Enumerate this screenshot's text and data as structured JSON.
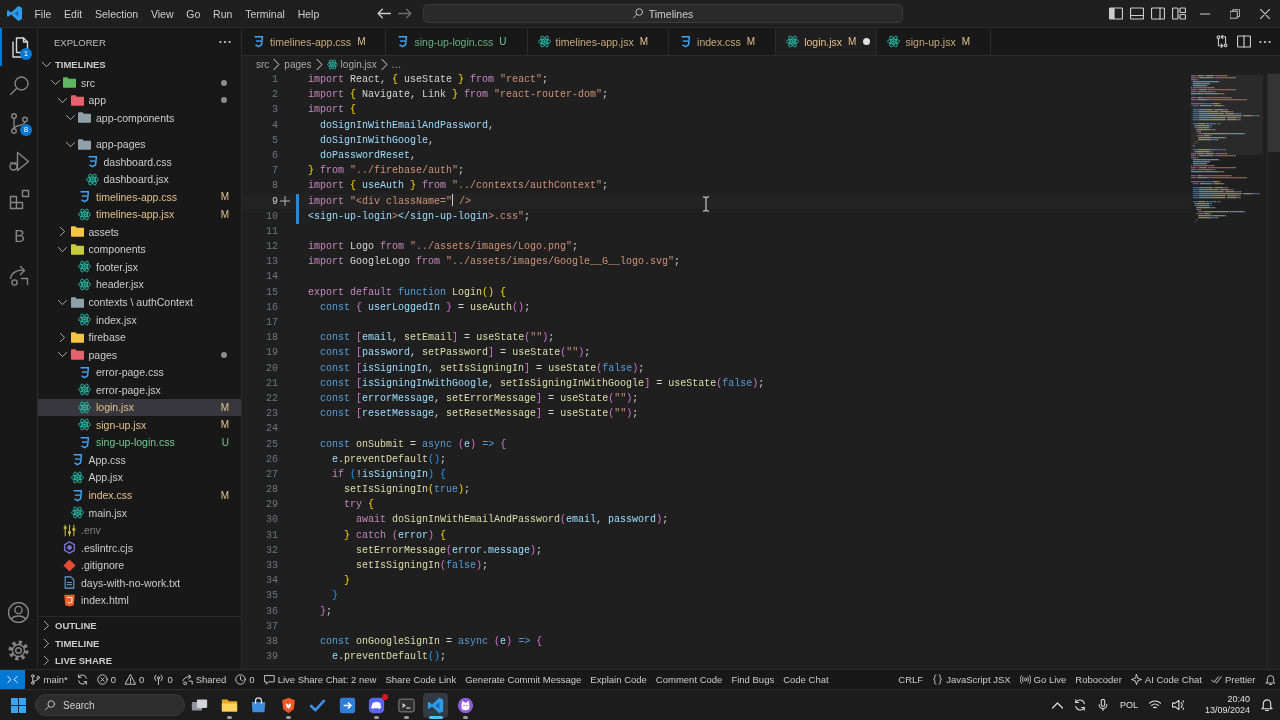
{
  "title_bar": {
    "menu": [
      "File",
      "Edit",
      "Selection",
      "View",
      "Go",
      "Run",
      "Terminal",
      "Help"
    ],
    "command_center": "Timelines"
  },
  "activity_bar": {
    "items": [
      {
        "kind": "files",
        "selected": true,
        "badge": "1"
      },
      {
        "kind": "search",
        "selected": false
      },
      {
        "kind": "source-control",
        "selected": false,
        "badge": "8"
      },
      {
        "kind": "run-debug",
        "selected": false
      },
      {
        "kind": "extensions",
        "selected": false
      },
      {
        "kind": "letter",
        "selected": false,
        "label": "B"
      },
      {
        "kind": "live-share",
        "selected": false
      }
    ],
    "bottom": [
      {
        "kind": "account"
      },
      {
        "kind": "settings"
      }
    ]
  },
  "sidebar": {
    "title": "EXPLORER",
    "workspace": {
      "title": "TIMELINES",
      "expanded": true
    },
    "tree": [
      {
        "name": "src",
        "kind": "folder",
        "color": "#5fb85f",
        "expanded": true,
        "changes": true,
        "selected": false,
        "children": [
          {
            "name": "app",
            "kind": "folder",
            "color": "#e8616f",
            "expanded": true,
            "changes": true,
            "selected": false,
            "children": [
              {
                "name": "app-components",
                "kind": "folder",
                "color": "#8fa0ab",
                "expanded": true,
                "changes": false,
                "selected": false
              },
              {
                "name": "app-pages",
                "kind": "folder",
                "color": "#8fa0ab",
                "expanded": true,
                "changes": false,
                "selected": false,
                "children": [
                  {
                    "name": "dashboard.css",
                    "kind": "css",
                    "modified": false,
                    "untracked": false,
                    "ignored": false,
                    "selected": false
                  },
                  {
                    "name": "dashboard.jsx",
                    "kind": "jsx",
                    "modified": false,
                    "untracked": false,
                    "ignored": false,
                    "selected": false
                  }
                ]
              },
              {
                "name": "timelines-app.css",
                "kind": "css",
                "modified": true,
                "untracked": false,
                "ignored": false,
                "badge": "M",
                "selected": false
              },
              {
                "name": "timelines-app.jsx",
                "kind": "jsx",
                "modified": true,
                "untracked": false,
                "ignored": false,
                "badge": "M",
                "selected": false
              }
            ]
          },
          {
            "name": "assets",
            "kind": "folder",
            "color": "#f4c542",
            "expanded": false,
            "changes": false,
            "selected": false
          },
          {
            "name": "components",
            "kind": "folder",
            "color": "#c5cc3a",
            "expanded": true,
            "changes": false,
            "selected": false,
            "children": [
              {
                "name": "footer.jsx",
                "kind": "jsx",
                "modified": false,
                "untracked": false,
                "ignored": false,
                "selected": false
              },
              {
                "name": "header.jsx",
                "kind": "jsx",
                "modified": false,
                "untracked": false,
                "ignored": false,
                "selected": false
              }
            ]
          },
          {
            "name": "contexts \\ authContext",
            "kind": "folder",
            "color": "#8fa0ab",
            "expanded": true,
            "changes": false,
            "selected": false,
            "children": [
              {
                "name": "index.jsx",
                "kind": "jsx",
                "modified": false,
                "untracked": false,
                "ignored": false,
                "selected": false
              }
            ]
          },
          {
            "name": "firebase",
            "kind": "folder",
            "color": "#f4c542",
            "expanded": false,
            "changes": false,
            "selected": false
          },
          {
            "name": "pages",
            "kind": "folder",
            "color": "#e8616f",
            "expanded": true,
            "changes": true,
            "selected": false,
            "children": [
              {
                "name": "error-page.css",
                "kind": "css",
                "modified": false,
                "untracked": false,
                "ignored": false,
                "selected": false
              },
              {
                "name": "error-page.jsx",
                "kind": "jsx",
                "modified": false,
                "untracked": false,
                "ignored": false,
                "selected": false
              },
              {
                "name": "login.jsx",
                "kind": "jsx",
                "modified": true,
                "untracked": false,
                "ignored": false,
                "badge": "M",
                "selected": true
              },
              {
                "name": "sign-up.jsx",
                "kind": "jsx",
                "modified": true,
                "untracked": false,
                "ignored": false,
                "badge": "M",
                "selected": false
              },
              {
                "name": "sing-up-login.css",
                "kind": "css",
                "modified": false,
                "untracked": true,
                "ignored": false,
                "badge": "U",
                "selected": false
              }
            ]
          },
          {
            "name": "App.css",
            "kind": "css",
            "modified": false,
            "untracked": false,
            "ignored": false,
            "selected": false
          },
          {
            "name": "App.jsx",
            "kind": "jsx",
            "modified": false,
            "untracked": false,
            "ignored": false,
            "selected": false
          },
          {
            "name": "index.css",
            "kind": "css",
            "modified": true,
            "untracked": false,
            "ignored": false,
            "badge": "M",
            "selected": false
          },
          {
            "name": "main.jsx",
            "kind": "jsx",
            "modified": false,
            "untracked": false,
            "ignored": false,
            "selected": false
          }
        ]
      },
      {
        "name": ".env",
        "kind": "env",
        "modified": false,
        "untracked": false,
        "ignored": true,
        "selected": false
      },
      {
        "name": ".eslintrc.cjs",
        "kind": "eslint",
        "modified": false,
        "untracked": false,
        "ignored": false,
        "selected": false
      },
      {
        "name": ".gitignore",
        "kind": "git",
        "modified": false,
        "untracked": false,
        "ignored": false,
        "selected": false
      },
      {
        "name": "days-with-no-work.txt",
        "kind": "txt",
        "modified": false,
        "untracked": false,
        "ignored": false,
        "selected": false
      },
      {
        "name": "index.html",
        "kind": "html",
        "modified": false,
        "untracked": false,
        "ignored": false,
        "selected": false
      }
    ],
    "sections": [
      {
        "title": "OUTLINE",
        "expanded": false
      },
      {
        "title": "TIMELINE",
        "expanded": false
      },
      {
        "title": "LIVE SHARE",
        "expanded": false
      }
    ]
  },
  "editor": {
    "tabs": [
      {
        "label": "timelines-app.css",
        "kind": "css",
        "badge": "M",
        "modified": true,
        "untracked": false,
        "selected": false,
        "dirty": false
      },
      {
        "label": "sing-up-login.css",
        "kind": "css",
        "badge": "U",
        "modified": false,
        "untracked": true,
        "selected": false,
        "dirty": false
      },
      {
        "label": "timelines-app.jsx",
        "kind": "jsx",
        "badge": "M",
        "modified": true,
        "untracked": false,
        "selected": false,
        "dirty": false
      },
      {
        "label": "index.css",
        "kind": "css",
        "badge": "M",
        "modified": true,
        "untracked": false,
        "selected": false,
        "dirty": false
      },
      {
        "label": "login.jsx",
        "kind": "jsx",
        "badge": "M",
        "modified": true,
        "untracked": false,
        "selected": true,
        "dirty": true
      },
      {
        "label": "sign-up.jsx",
        "kind": "jsx",
        "badge": "M",
        "modified": true,
        "untracked": false,
        "selected": false,
        "dirty": false
      }
    ],
    "breadcrumbs": [
      {
        "label": "src",
        "kind": "folder"
      },
      {
        "label": "pages",
        "kind": "folder"
      },
      {
        "label": "login.jsx",
        "kind": "jsx"
      },
      {
        "label": "...",
        "kind": "more"
      }
    ],
    "lines": [
      {
        "number": "1",
        "active": false,
        "changed": false,
        "tokens": [
          {
            "kind": "kw",
            "text": "import"
          },
          {
            "kind": "pl",
            "text": " React, "
          },
          {
            "kind": "b1",
            "text": "{"
          },
          {
            "kind": "pl",
            "text": " useState "
          },
          {
            "kind": "b1",
            "text": "}"
          },
          {
            "kind": "kw",
            "text": " from "
          },
          {
            "kind": "str",
            "text": "\"react\""
          },
          {
            "kind": "pl",
            "text": ";"
          }
        ]
      },
      {
        "number": "2",
        "active": false,
        "changed": false,
        "tokens": [
          {
            "kind": "kw",
            "text": "import"
          },
          {
            "kind": "b1",
            "text": " {"
          },
          {
            "kind": "pl",
            "text": " Navigate, Link "
          },
          {
            "kind": "b1",
            "text": "}"
          },
          {
            "kind": "kw",
            "text": " from "
          },
          {
            "kind": "str",
            "text": "\"react-router-dom\""
          },
          {
            "kind": "pl",
            "text": ";"
          }
        ]
      },
      {
        "number": "3",
        "active": false,
        "changed": false,
        "tokens": [
          {
            "kind": "kw",
            "text": "import"
          },
          {
            "kind": "b1",
            "text": " {"
          }
        ]
      },
      {
        "number": "4",
        "active": false,
        "changed": false,
        "tokens": [
          {
            "kind": "var",
            "text": "  doSignInWithEmailAndPassword"
          },
          {
            "kind": "pl",
            "text": ","
          }
        ]
      },
      {
        "number": "5",
        "active": false,
        "changed": false,
        "tokens": [
          {
            "kind": "var",
            "text": "  doSignInWithGoogle"
          },
          {
            "kind": "pl",
            "text": ","
          }
        ]
      },
      {
        "number": "6",
        "active": false,
        "changed": false,
        "tokens": [
          {
            "kind": "var",
            "text": "  doPasswordReset"
          },
          {
            "kind": "pl",
            "text": ","
          }
        ]
      },
      {
        "number": "7",
        "active": false,
        "changed": false,
        "tokens": [
          {
            "kind": "b1",
            "text": "}"
          },
          {
            "kind": "kw",
            "text": " from "
          },
          {
            "kind": "str",
            "text": "\"../firebase/auth\""
          },
          {
            "kind": "pl",
            "text": ";"
          }
        ]
      },
      {
        "number": "8",
        "active": false,
        "changed": false,
        "tokens": [
          {
            "kind": "kw",
            "text": "import"
          },
          {
            "kind": "b1",
            "text": " {"
          },
          {
            "kind": "var",
            "text": " useAuth "
          },
          {
            "kind": "b1",
            "text": "}"
          },
          {
            "kind": "kw",
            "text": " from "
          },
          {
            "kind": "str",
            "text": "\"../contexts/authContext\""
          },
          {
            "kind": "pl",
            "text": ";"
          }
        ]
      },
      {
        "number": "9",
        "active": true,
        "changed": true,
        "tokens": [
          {
            "kind": "kw",
            "text": "import"
          },
          {
            "kind": "str",
            "text": " \"<div className=\""
          },
          {
            "kind": "caret"
          },
          {
            "kind": "str",
            "text": " />"
          }
        ]
      },
      {
        "number": "10",
        "active": false,
        "changed": true,
        "tokens": [
          {
            "kind": "var",
            "text": "<sign-up-login"
          },
          {
            "kind": "str",
            "text": ">"
          },
          {
            "kind": "var",
            "text": "</sign-up-login"
          },
          {
            "kind": "str",
            "text": ">.css\""
          },
          {
            "kind": "pl",
            "text": ";"
          }
        ]
      },
      {
        "number": "11",
        "active": false,
        "changed": false
      },
      {
        "number": "12",
        "active": false,
        "changed": false,
        "tokens": [
          {
            "kind": "kw",
            "text": "import"
          },
          {
            "kind": "pl",
            "text": " Logo "
          },
          {
            "kind": "kw",
            "text": "from "
          },
          {
            "kind": "str",
            "text": "\"../assets/images/Logo.png\""
          },
          {
            "kind": "pl",
            "text": ";"
          }
        ]
      },
      {
        "number": "13",
        "active": false,
        "changed": false,
        "tokens": [
          {
            "kind": "kw",
            "text": "import"
          },
          {
            "kind": "pl",
            "text": " GoogleLogo "
          },
          {
            "kind": "kw",
            "text": "from "
          },
          {
            "kind": "str",
            "text": "\"../assets/images/Google__G__logo.svg\""
          },
          {
            "kind": "pl",
            "text": ";"
          }
        ]
      },
      {
        "number": "14",
        "active": false,
        "changed": false
      },
      {
        "number": "15",
        "active": false,
        "changed": false,
        "tokens": [
          {
            "kind": "kw",
            "text": "export default "
          },
          {
            "kind": "st",
            "text": "function "
          },
          {
            "kind": "fn",
            "text": "Login"
          },
          {
            "kind": "b1",
            "text": "()"
          },
          {
            "kind": "b1",
            "text": " {"
          }
        ]
      },
      {
        "number": "16",
        "active": false,
        "changed": false,
        "tokens": [
          {
            "kind": "st",
            "text": "  const "
          },
          {
            "kind": "b2",
            "text": "{"
          },
          {
            "kind": "var",
            "text": " userLoggedIn "
          },
          {
            "kind": "b2",
            "text": "}"
          },
          {
            "kind": "pl",
            "text": " = "
          },
          {
            "kind": "fn",
            "text": "useAuth"
          },
          {
            "kind": "b2",
            "text": "()"
          },
          {
            "kind": "pl",
            "text": ";"
          }
        ]
      },
      {
        "number": "17",
        "active": false,
        "changed": false
      },
      {
        "number": "18",
        "active": false,
        "changed": false,
        "tokens": [
          {
            "kind": "st",
            "text": "  const "
          },
          {
            "kind": "b2",
            "text": "["
          },
          {
            "kind": "var",
            "text": "email"
          },
          {
            "kind": "pl",
            "text": ", "
          },
          {
            "kind": "fn",
            "text": "setEmail"
          },
          {
            "kind": "b2",
            "text": "]"
          },
          {
            "kind": "pl",
            "text": " = "
          },
          {
            "kind": "fn",
            "text": "useState"
          },
          {
            "kind": "b2",
            "text": "("
          },
          {
            "kind": "str",
            "text": "\"\""
          },
          {
            "kind": "b2",
            "text": ")"
          },
          {
            "kind": "pl",
            "text": ";"
          }
        ]
      },
      {
        "number": "19",
        "active": false,
        "changed": false,
        "tokens": [
          {
            "kind": "st",
            "text": "  const "
          },
          {
            "kind": "b2",
            "text": "["
          },
          {
            "kind": "var",
            "text": "password"
          },
          {
            "kind": "pl",
            "text": ", "
          },
          {
            "kind": "fn",
            "text": "setPassword"
          },
          {
            "kind": "b2",
            "text": "]"
          },
          {
            "kind": "pl",
            "text": " = "
          },
          {
            "kind": "fn",
            "text": "useState"
          },
          {
            "kind": "b2",
            "text": "("
          },
          {
            "kind": "str",
            "text": "\"\""
          },
          {
            "kind": "b2",
            "text": ")"
          },
          {
            "kind": "pl",
            "text": ";"
          }
        ]
      },
      {
        "number": "20",
        "active": false,
        "changed": false,
        "tokens": [
          {
            "kind": "st",
            "text": "  const "
          },
          {
            "kind": "b2",
            "text": "["
          },
          {
            "kind": "var",
            "text": "isSigningIn"
          },
          {
            "kind": "pl",
            "text": ", "
          },
          {
            "kind": "fn",
            "text": "setIsSigningIn"
          },
          {
            "kind": "b2",
            "text": "]"
          },
          {
            "kind": "pl",
            "text": " = "
          },
          {
            "kind": "fn",
            "text": "useState"
          },
          {
            "kind": "b2",
            "text": "("
          },
          {
            "kind": "st",
            "text": "false"
          },
          {
            "kind": "b2",
            "text": ")"
          },
          {
            "kind": "pl",
            "text": ";"
          }
        ]
      },
      {
        "number": "21",
        "active": false,
        "changed": false,
        "tokens": [
          {
            "kind": "st",
            "text": "  const "
          },
          {
            "kind": "b2",
            "text": "["
          },
          {
            "kind": "var",
            "text": "isSigningInWithGoogle"
          },
          {
            "kind": "pl",
            "text": ", "
          },
          {
            "kind": "fn",
            "text": "setIsSigningInWithGoogle"
          },
          {
            "kind": "b2",
            "text": "]"
          },
          {
            "kind": "pl",
            "text": " = "
          },
          {
            "kind": "fn",
            "text": "useState"
          },
          {
            "kind": "b2",
            "text": "("
          },
          {
            "kind": "st",
            "text": "false"
          },
          {
            "kind": "b2",
            "text": ")"
          },
          {
            "kind": "pl",
            "text": ";"
          }
        ]
      },
      {
        "number": "22",
        "active": false,
        "changed": false,
        "tokens": [
          {
            "kind": "st",
            "text": "  const "
          },
          {
            "kind": "b2",
            "text": "["
          },
          {
            "kind": "var",
            "text": "errorMessage"
          },
          {
            "kind": "pl",
            "text": ", "
          },
          {
            "kind": "fn",
            "text": "setErrorMessage"
          },
          {
            "kind": "b2",
            "text": "]"
          },
          {
            "kind": "pl",
            "text": " = "
          },
          {
            "kind": "fn",
            "text": "useState"
          },
          {
            "kind": "b2",
            "text": "("
          },
          {
            "kind": "str",
            "text": "\"\""
          },
          {
            "kind": "b2",
            "text": ")"
          },
          {
            "kind": "pl",
            "text": ";"
          }
        ]
      },
      {
        "number": "23",
        "active": false,
        "changed": false,
        "tokens": [
          {
            "kind": "st",
            "text": "  const "
          },
          {
            "kind": "b2",
            "text": "["
          },
          {
            "kind": "var",
            "text": "resetMessage"
          },
          {
            "kind": "pl",
            "text": ", "
          },
          {
            "kind": "fn",
            "text": "setResetMessage"
          },
          {
            "kind": "b2",
            "text": "]"
          },
          {
            "kind": "pl",
            "text": " = "
          },
          {
            "kind": "fn",
            "text": "useState"
          },
          {
            "kind": "b2",
            "text": "("
          },
          {
            "kind": "str",
            "text": "\"\""
          },
          {
            "kind": "b2",
            "text": ")"
          },
          {
            "kind": "pl",
            "text": ";"
          }
        ]
      },
      {
        "number": "24",
        "active": false,
        "changed": false
      },
      {
        "number": "25",
        "active": false,
        "changed": false,
        "tokens": [
          {
            "kind": "st",
            "text": "  const "
          },
          {
            "kind": "fn",
            "text": "onSubmit"
          },
          {
            "kind": "pl",
            "text": " = "
          },
          {
            "kind": "st",
            "text": "async "
          },
          {
            "kind": "b2",
            "text": "("
          },
          {
            "kind": "var",
            "text": "e"
          },
          {
            "kind": "b2",
            "text": ")"
          },
          {
            "kind": "st",
            "text": " => "
          },
          {
            "kind": "b2",
            "text": "{"
          }
        ]
      },
      {
        "number": "26",
        "active": false,
        "changed": false,
        "tokens": [
          {
            "kind": "var",
            "text": "    e"
          },
          {
            "kind": "pl",
            "text": "."
          },
          {
            "kind": "fn",
            "text": "preventDefault"
          },
          {
            "kind": "b3",
            "text": "()"
          },
          {
            "kind": "pl",
            "text": ";"
          }
        ]
      },
      {
        "number": "27",
        "active": false,
        "changed": false,
        "tokens": [
          {
            "kind": "kw",
            "text": "    if "
          },
          {
            "kind": "b3",
            "text": "("
          },
          {
            "kind": "pl",
            "text": "!"
          },
          {
            "kind": "var",
            "text": "isSigningIn"
          },
          {
            "kind": "b3",
            "text": ")"
          },
          {
            "kind": "b3",
            "text": " {"
          }
        ]
      },
      {
        "number": "28",
        "active": false,
        "changed": false,
        "tokens": [
          {
            "kind": "fn",
            "text": "      setIsSigningIn"
          },
          {
            "kind": "b1",
            "text": "("
          },
          {
            "kind": "st",
            "text": "true"
          },
          {
            "kind": "b1",
            "text": ")"
          },
          {
            "kind": "pl",
            "text": ";"
          }
        ]
      },
      {
        "number": "29",
        "active": false,
        "changed": false,
        "tokens": [
          {
            "kind": "kw",
            "text": "      try "
          },
          {
            "kind": "b1",
            "text": "{"
          }
        ]
      },
      {
        "number": "30",
        "active": false,
        "changed": false,
        "tokens": [
          {
            "kind": "kw",
            "text": "        await "
          },
          {
            "kind": "fn",
            "text": "doSignInWithEmailAndPassword"
          },
          {
            "kind": "b2",
            "text": "("
          },
          {
            "kind": "var",
            "text": "email"
          },
          {
            "kind": "pl",
            "text": ", "
          },
          {
            "kind": "var",
            "text": "password"
          },
          {
            "kind": "b2",
            "text": ")"
          },
          {
            "kind": "pl",
            "text": ";"
          }
        ]
      },
      {
        "number": "31",
        "active": false,
        "changed": false,
        "tokens": [
          {
            "kind": "b1",
            "text": "      }"
          },
          {
            "kind": "kw",
            "text": " catch "
          },
          {
            "kind": "b2",
            "text": "("
          },
          {
            "kind": "var",
            "text": "error"
          },
          {
            "kind": "b2",
            "text": ")"
          },
          {
            "kind": "b1",
            "text": " {"
          }
        ]
      },
      {
        "number": "32",
        "active": false,
        "changed": false,
        "tokens": [
          {
            "kind": "fn",
            "text": "        setErrorMessage"
          },
          {
            "kind": "b2",
            "text": "("
          },
          {
            "kind": "var",
            "text": "error"
          },
          {
            "kind": "pl",
            "text": "."
          },
          {
            "kind": "var",
            "text": "message"
          },
          {
            "kind": "b2",
            "text": ")"
          },
          {
            "kind": "pl",
            "text": ";"
          }
        ]
      },
      {
        "number": "33",
        "active": false,
        "changed": false,
        "tokens": [
          {
            "kind": "fn",
            "text": "        setIsSigningIn"
          },
          {
            "kind": "b2",
            "text": "("
          },
          {
            "kind": "st",
            "text": "false"
          },
          {
            "kind": "b2",
            "text": ")"
          },
          {
            "kind": "pl",
            "text": ";"
          }
        ]
      },
      {
        "number": "34",
        "active": false,
        "changed": false,
        "tokens": [
          {
            "kind": "b1",
            "text": "      }"
          }
        ]
      },
      {
        "number": "35",
        "active": false,
        "changed": false,
        "tokens": [
          {
            "kind": "b3",
            "text": "    }"
          }
        ]
      },
      {
        "number": "36",
        "active": false,
        "changed": false,
        "tokens": [
          {
            "kind": "b2",
            "text": "  }"
          },
          {
            "kind": "pl",
            "text": ";"
          }
        ]
      },
      {
        "number": "37",
        "active": false,
        "changed": false
      },
      {
        "number": "38",
        "active": false,
        "changed": false,
        "tokens": [
          {
            "kind": "st",
            "text": "  const "
          },
          {
            "kind": "fn",
            "text": "onGoogleSignIn"
          },
          {
            "kind": "pl",
            "text": " = "
          },
          {
            "kind": "st",
            "text": "async "
          },
          {
            "kind": "b2",
            "text": "("
          },
          {
            "kind": "var",
            "text": "e"
          },
          {
            "kind": "b2",
            "text": ")"
          },
          {
            "kind": "st",
            "text": " => "
          },
          {
            "kind": "b2",
            "text": "{"
          }
        ]
      },
      {
        "number": "39",
        "active": false,
        "changed": false,
        "tokens": [
          {
            "kind": "var",
            "text": "    e"
          },
          {
            "kind": "pl",
            "text": "."
          },
          {
            "kind": "fn",
            "text": "preventDefault"
          },
          {
            "kind": "b3",
            "text": "()"
          },
          {
            "kind": "pl",
            "text": ";"
          }
        ]
      }
    ]
  },
  "status_bar": {
    "left": [
      {
        "kind": "remote"
      },
      {
        "kind": "branch",
        "label": "main*"
      },
      {
        "kind": "sync"
      },
      {
        "kind": "error",
        "label": "0"
      },
      {
        "kind": "warning",
        "label": "0"
      },
      {
        "kind": "ports",
        "label": "0"
      },
      {
        "kind": "live-share",
        "label": "Shared"
      },
      {
        "kind": "clock",
        "label": "0"
      },
      {
        "kind": "chat",
        "label": "Live Share Chat: 2 new"
      },
      {
        "kind": "text",
        "label": "Share Code Link"
      },
      {
        "kind": "text",
        "label": "Generate Commit Message"
      },
      {
        "kind": "text",
        "label": "Explain Code"
      },
      {
        "kind": "text",
        "label": "Comment Code"
      },
      {
        "kind": "text",
        "label": "Find Bugs"
      },
      {
        "kind": "text",
        "label": "Code Chat"
      }
    ],
    "right": [
      {
        "kind": "text",
        "label": "CRLF"
      },
      {
        "kind": "braces",
        "label": "JavaScript JSX"
      },
      {
        "kind": "broadcast",
        "label": "Go Live"
      },
      {
        "kind": "text",
        "label": "Robocoder"
      },
      {
        "kind": "sparkle",
        "label": "AI Code Chat"
      },
      {
        "kind": "double-check",
        "label": "Prettier"
      },
      {
        "kind": "bell"
      }
    ]
  },
  "taskbar": {
    "search": {
      "placeholder": "Search"
    },
    "apps": [
      {
        "kind": "task-view",
        "running": false,
        "active": false,
        "notification": false
      },
      {
        "kind": "folder",
        "running": true,
        "active": false,
        "notification": false
      },
      {
        "kind": "store",
        "running": false,
        "active": false,
        "notification": false
      },
      {
        "kind": "shield",
        "running": true,
        "active": false,
        "notification": false
      },
      {
        "kind": "check",
        "running": false,
        "active": false,
        "notification": false
      },
      {
        "kind": "arrow-box",
        "running": false,
        "active": false,
        "notification": false
      },
      {
        "kind": "controller",
        "running": true,
        "active": false,
        "notification": true
      },
      {
        "kind": "terminal",
        "running": true,
        "active": false,
        "notification": false
      },
      {
        "kind": "ribbon",
        "running": true,
        "active": true,
        "notification": false
      },
      {
        "kind": "cat",
        "running": true,
        "active": false,
        "notification": false
      }
    ],
    "tray": {
      "language": "POL",
      "time": "20:40",
      "date": "13/09/2024"
    }
  }
}
